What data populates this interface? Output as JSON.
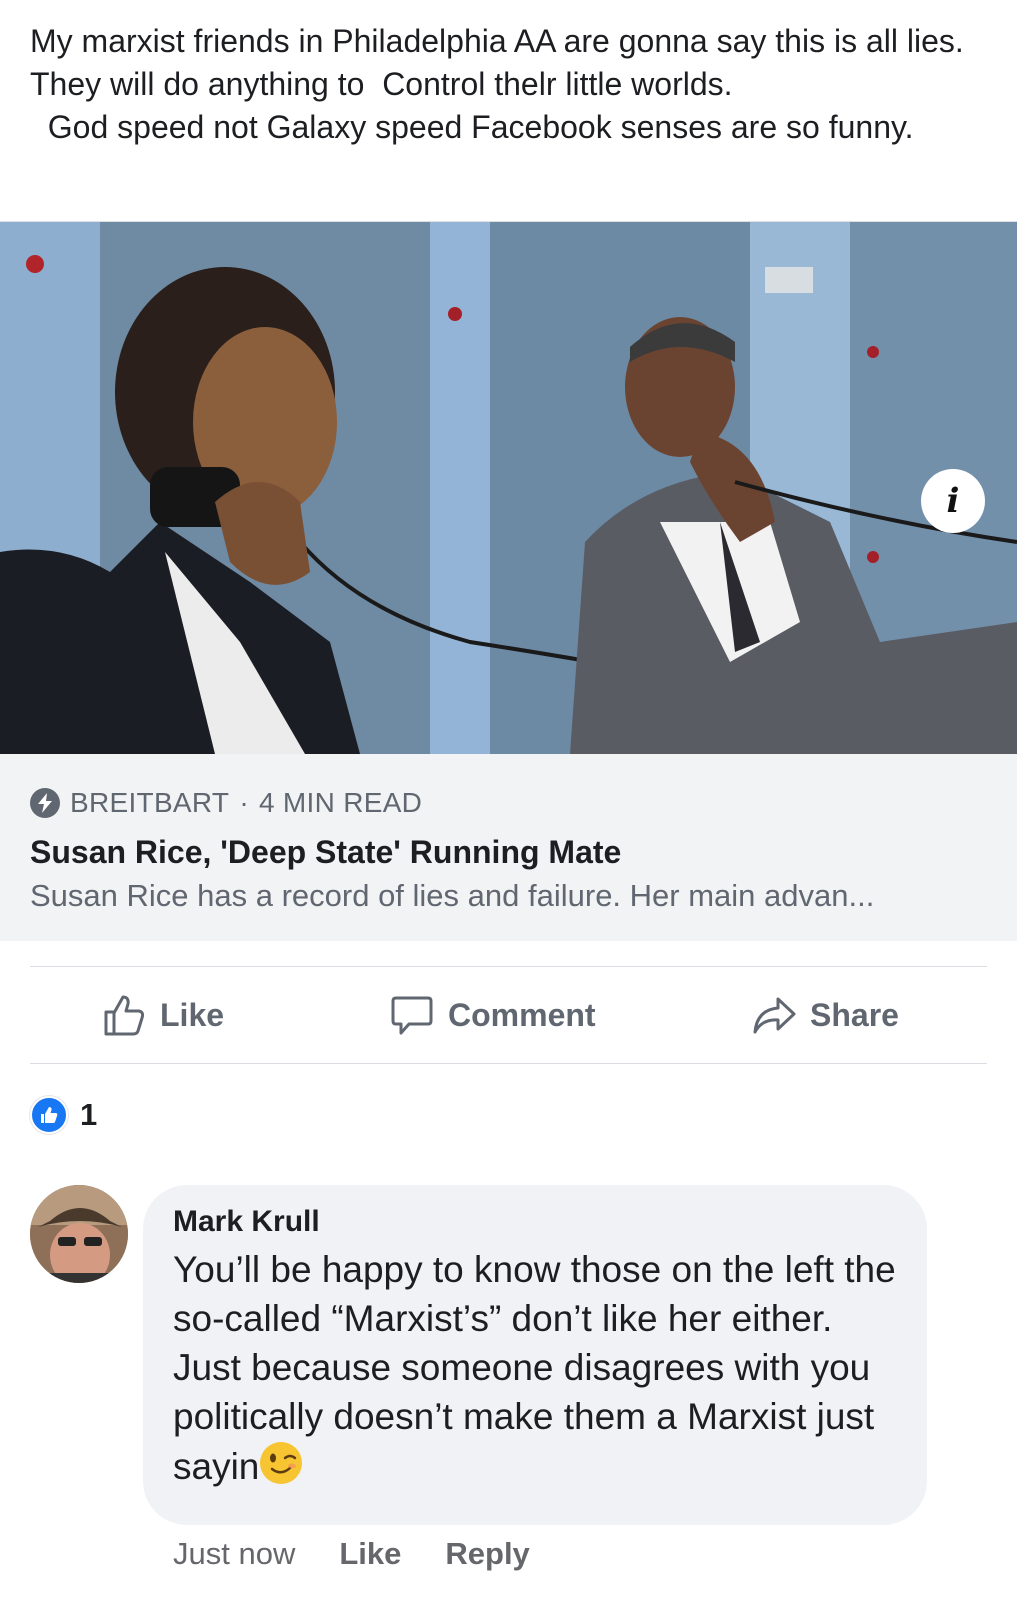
{
  "post": {
    "text": "My marxist friends in Philadelphia AA are gonna say this is all lies. They will do anything to  Control thelr little worlds.\n  God speed not Galaxy speed Facebook senses are so funny."
  },
  "link": {
    "info_glyph": "i",
    "source": "BREITBART",
    "separator": "·",
    "read_time": "4 MIN READ",
    "title": "Susan Rice, 'Deep State' Running Mate",
    "description": "Susan Rice has a record of lies and failure. Her main advan..."
  },
  "actions": {
    "like": "Like",
    "comment": "Comment",
    "share": "Share"
  },
  "reactions": {
    "count": "1"
  },
  "comment": {
    "author": "Mark Krull",
    "body": "You’ll be happy to know those on the left the so-called “Marxist’s” don’t like her either. Just because someone disagrees with you politically doesn’t make them a Marxist just sayin",
    "timestamp": "Just now",
    "like": "Like",
    "reply": "Reply"
  },
  "colors": {
    "accent": "#1877f2",
    "meta_bg": "#f2f3f5",
    "secondary_text": "#606770"
  }
}
